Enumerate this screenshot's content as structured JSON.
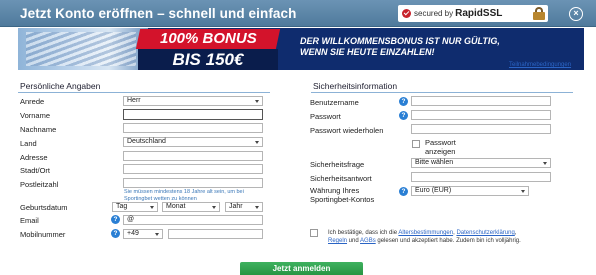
{
  "header": {
    "title": "Jetzt Konto eröffnen – schnell und einfach",
    "ssl_prefix": "secured by",
    "ssl_brand": "RapidSSL",
    "close_label": "×"
  },
  "banner": {
    "bonus_top": "100% BONUS",
    "bonus_bottom": "BIS 150€",
    "message_line1": "DER WILLKOMMENSBONUS IST NUR GÜLTIG,",
    "message_line2": "WENN SIE HEUTE EINZAHLEN!"
  },
  "terms_link": "Teilnahmebedingungen",
  "personal": {
    "title": "Persönliche Angaben",
    "salutation_label": "Anrede",
    "salutation_value": "Herr",
    "firstname_label": "Vorname",
    "lastname_label": "Nachname",
    "country_label": "Land",
    "country_value": "Deutschland",
    "address_label": "Adresse",
    "city_label": "Stadt/Ort",
    "zip_label": "Postleitzahl",
    "age_hint_line1": "Sie müssen mindestens 18 Jahre alt sein, um bei",
    "age_hint_line2": "Sportingbet wetten zu können",
    "birthdate_label": "Geburtsdatum",
    "day_value": "Tag",
    "month_value": "Monat",
    "year_value": "Jahr",
    "email_label": "Email",
    "email_value": "@",
    "mobile_label": "Mobilnummer",
    "mobile_prefix": "+49"
  },
  "security": {
    "title": "Sicherheitsinformation",
    "username_label": "Benutzername",
    "password_label": "Passwort",
    "password_repeat_label": "Passwort wiederholen",
    "show_password_label_line1": "Passwort",
    "show_password_label_line2": "anzeigen",
    "question_label": "Sicherheitsfrage",
    "question_value": "Bitte wählen",
    "answer_label": "Sicherheitsantwort",
    "currency_label_line1": "Währung Ihres",
    "currency_label_line2": "Sportingbet-Kontos",
    "currency_value": "Euro (EUR)"
  },
  "consent": {
    "prefix": "Ich bestätige, dass ich die",
    "link_age": "Altersbestimmungen",
    "sep1": ", ",
    "link_privacy": "Datenschutzerklärung",
    "sep2": ",",
    "link_rules": "Regeln",
    "sep3": " und ",
    "link_agb": "AGBs",
    "suffix": " gelesen und akzeptiert habe. Zudem bin ich volljährig."
  },
  "submit_label": "Jetzt anmelden",
  "help_glyph": "?",
  "colors": {
    "header": "#5a86a8",
    "banner_red": "#d3132b",
    "banner_dark": "#0a1d4c",
    "link": "#2a64c5",
    "submit": "#2fa04e"
  }
}
